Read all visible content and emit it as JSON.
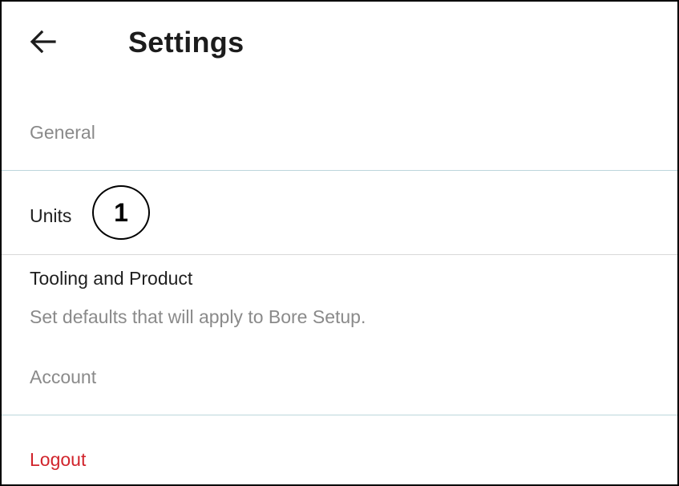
{
  "header": {
    "title": "Settings",
    "back_icon": "arrow-left-icon"
  },
  "sections": {
    "general_label": "General",
    "account_label": "Account"
  },
  "items": {
    "units": {
      "label": "Units",
      "callout_number": "1"
    },
    "tooling": {
      "label": "Tooling and Product",
      "description": "Set defaults that will apply to Bore Setup."
    },
    "logout": {
      "label": "Logout"
    }
  },
  "colors": {
    "logout_text": "#d1242c",
    "section_text": "#8a8a8a",
    "divider": "#bcd6dc"
  }
}
